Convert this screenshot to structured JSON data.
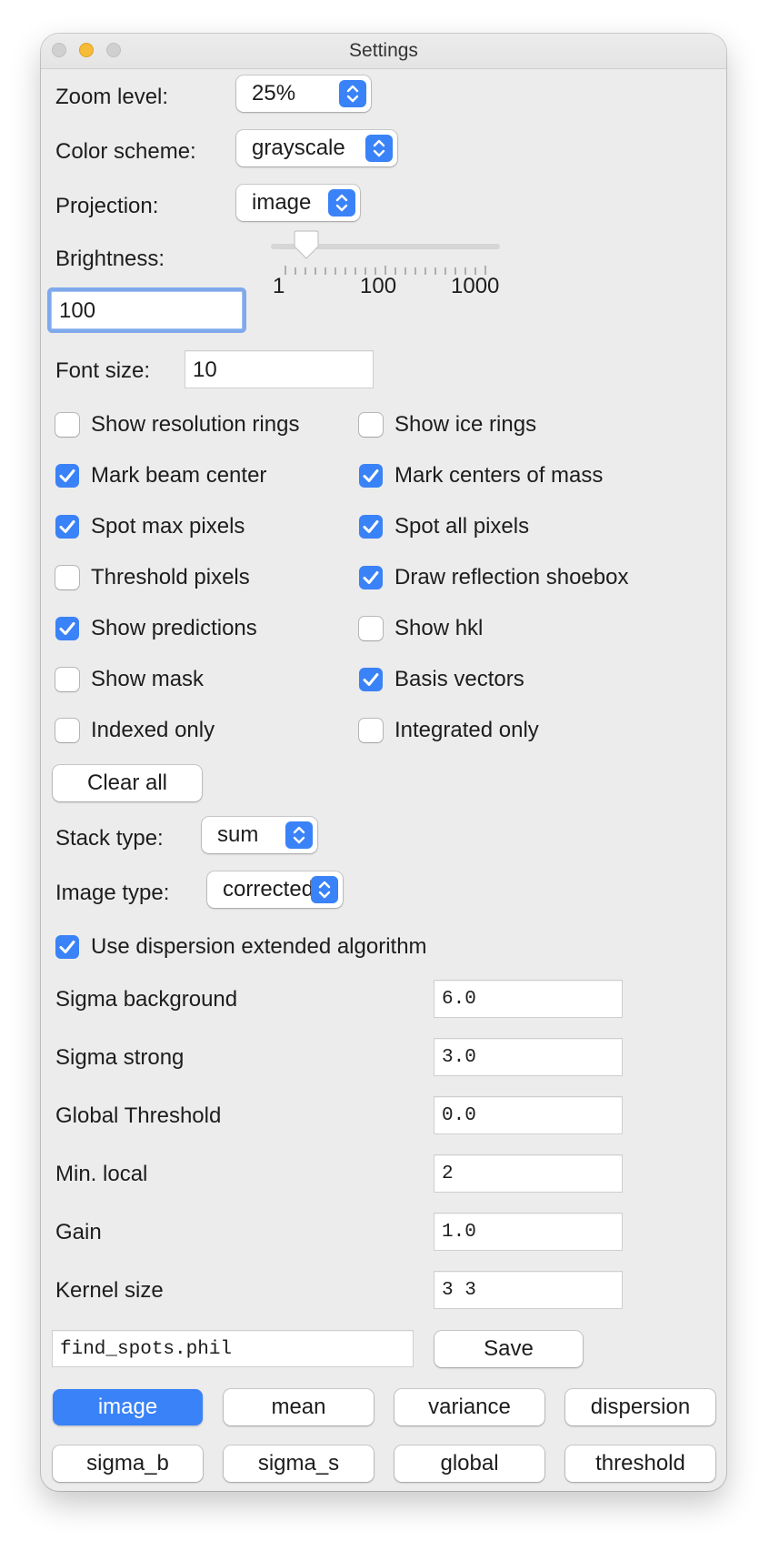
{
  "window": {
    "title": "Settings"
  },
  "zoom": {
    "label": "Zoom level:",
    "value": "25%"
  },
  "color_scheme": {
    "label": "Color scheme:",
    "value": "grayscale"
  },
  "projection": {
    "label": "Projection:",
    "value": "image"
  },
  "brightness": {
    "label": "Brightness:",
    "value": "100",
    "slider_ticks": [
      "1",
      "100",
      "1000"
    ],
    "slider_level_fraction": 0.12
  },
  "font_size": {
    "label": "Font size:",
    "value": "10"
  },
  "checkboxes": [
    {
      "label": "Show resolution rings",
      "checked": false
    },
    {
      "label": "Show ice rings",
      "checked": false
    },
    {
      "label": "Mark beam center",
      "checked": true
    },
    {
      "label": "Mark centers of mass",
      "checked": true
    },
    {
      "label": "Spot max pixels",
      "checked": true
    },
    {
      "label": "Spot all pixels",
      "checked": true
    },
    {
      "label": "Threshold pixels",
      "checked": false
    },
    {
      "label": "Draw reflection shoebox",
      "checked": true
    },
    {
      "label": "Show predictions",
      "checked": true
    },
    {
      "label": "Show hkl",
      "checked": false
    },
    {
      "label": "Show mask",
      "checked": false
    },
    {
      "label": "Basis vectors",
      "checked": true
    },
    {
      "label": "Indexed only",
      "checked": false
    },
    {
      "label": "Integrated only",
      "checked": false
    }
  ],
  "clear_all_label": "Clear all",
  "stack_type": {
    "label": "Stack type:",
    "value": "sum"
  },
  "image_type": {
    "label": "Image type:",
    "value": "corrected"
  },
  "dispersion_extended": {
    "label": "Use dispersion extended algorithm",
    "checked": true
  },
  "params": [
    {
      "label": "Sigma background",
      "value": "6.0"
    },
    {
      "label": "Sigma strong",
      "value": "3.0"
    },
    {
      "label": "Global Threshold",
      "value": "0.0"
    },
    {
      "label": "Min. local",
      "value": "2"
    },
    {
      "label": "Gain",
      "value": "1.0"
    },
    {
      "label": "Kernel size",
      "value": "3 3"
    }
  ],
  "save": {
    "filename": "find_spots.phil",
    "button_label": "Save"
  },
  "view_buttons": [
    {
      "label": "image",
      "selected": true
    },
    {
      "label": "mean",
      "selected": false
    },
    {
      "label": "variance",
      "selected": false
    },
    {
      "label": "dispersion",
      "selected": false
    },
    {
      "label": "sigma_b",
      "selected": false
    },
    {
      "label": "sigma_s",
      "selected": false
    },
    {
      "label": "global",
      "selected": false
    },
    {
      "label": "threshold",
      "selected": false
    }
  ],
  "colors": {
    "accent": "#3a82f7",
    "window_bg": "#ececec",
    "minimize": "#f6bb37"
  }
}
